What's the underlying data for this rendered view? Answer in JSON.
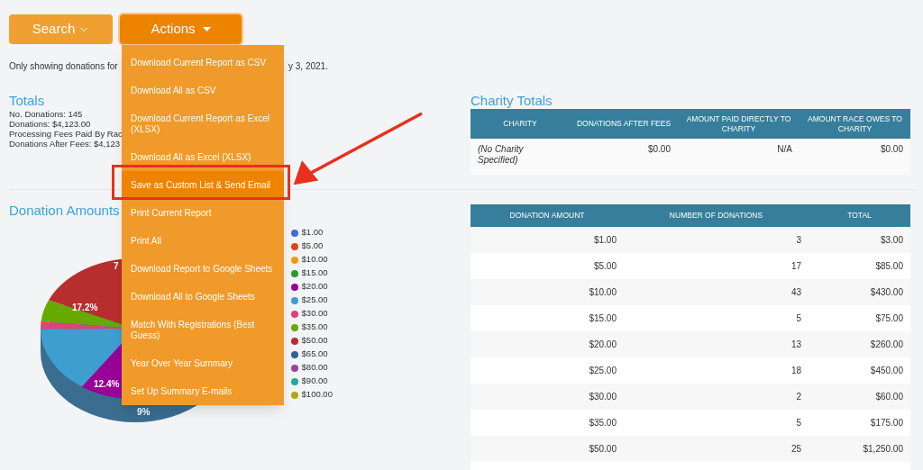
{
  "toolbar": {
    "search_button": "Search",
    "actions_button": "Actions"
  },
  "actions_menu": [
    {
      "label": "Download Current Report as CSV",
      "selected": false
    },
    {
      "label": "Download All as CSV",
      "selected": false
    },
    {
      "label": "Download Current Report as Excel (XLSX)",
      "selected": false
    },
    {
      "label": "Download All as Excel (XLSX)",
      "selected": false
    },
    {
      "label": "Save as Custom List & Send Email",
      "selected": true
    },
    {
      "label": "Print Current Report",
      "selected": false
    },
    {
      "label": "Print All",
      "selected": false
    },
    {
      "label": "Download Report to Google Sheets",
      "selected": false
    },
    {
      "label": "Download All to Google Sheets",
      "selected": false
    },
    {
      "label": "Match With Registrations (Best Guess)",
      "selected": false
    },
    {
      "label": "Year Over Year Summary",
      "selected": false
    },
    {
      "label": "Set Up Summary E-mails",
      "selected": false
    }
  ],
  "notice": [
    "Only showing donations for",
    "y 3, 2021."
  ],
  "totals": {
    "title": "Totals",
    "lines": [
      "No. Donations: 145",
      "Donations: $4,123.00",
      "Processing Fees Paid By Rac",
      "Donations After Fees: $4,123"
    ]
  },
  "charity_totals": {
    "title": "Charity Totals",
    "columns": [
      "CHARITY",
      "DONATIONS AFTER FEES",
      "AMOUNT PAID DIRECTLY TO CHARITY",
      "AMOUNT RACE OWES TO CHARITY"
    ],
    "rows": [
      [
        "(No Charity Specified)",
        "$0.00",
        "N/A",
        "$0.00"
      ]
    ]
  },
  "donation_amounts": {
    "title": "Donation Amounts",
    "slice_labels": [
      "17.2%",
      "12.4%",
      "9%",
      "7"
    ],
    "legend": [
      {
        "label": "$1.00",
        "color": "#3d6fd6"
      },
      {
        "label": "$5.00",
        "color": "#dd4418"
      },
      {
        "label": "$10.00",
        "color": "#f59a0b"
      },
      {
        "label": "$15.00",
        "color": "#2e9a2a"
      },
      {
        "label": "$20.00",
        "color": "#990099"
      },
      {
        "label": "$25.00",
        "color": "#3f9ed0"
      },
      {
        "label": "$30.00",
        "color": "#dd4477"
      },
      {
        "label": "$35.00",
        "color": "#66aa00"
      },
      {
        "label": "$50.00",
        "color": "#b82e2e"
      },
      {
        "label": "$65.00",
        "color": "#316395"
      },
      {
        "label": "$80.00",
        "color": "#994499"
      },
      {
        "label": "$90.00",
        "color": "#22aa99"
      },
      {
        "label": "$100.00",
        "color": "#aaaa11"
      }
    ]
  },
  "amounts_table": {
    "columns": [
      "DONATION AMOUNT",
      "NUMBER OF DONATIONS",
      "TOTAL"
    ],
    "rows": [
      [
        "$1.00",
        "3",
        "$3.00"
      ],
      [
        "$5.00",
        "17",
        "$85.00"
      ],
      [
        "$10.00",
        "43",
        "$430.00"
      ],
      [
        "$15.00",
        "5",
        "$75.00"
      ],
      [
        "$20.00",
        "13",
        "$260.00"
      ],
      [
        "$25.00",
        "18",
        "$450.00"
      ],
      [
        "$30.00",
        "2",
        "$60.00"
      ],
      [
        "$35.00",
        "5",
        "$175.00"
      ],
      [
        "$50.00",
        "25",
        "$1,250.00"
      ]
    ]
  }
}
